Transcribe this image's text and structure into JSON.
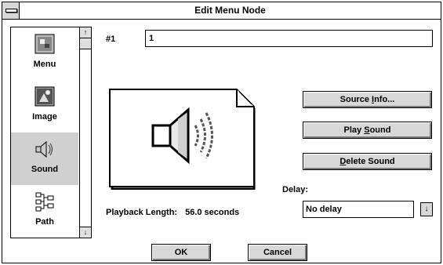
{
  "window": {
    "title": "Edit Menu Node"
  },
  "sidebar": {
    "items": [
      {
        "label": "Menu",
        "icon": "menu-icon",
        "selected": false
      },
      {
        "label": "Image",
        "icon": "image-icon",
        "selected": false
      },
      {
        "label": "Sound",
        "icon": "speaker-icon",
        "selected": true
      },
      {
        "label": "Path",
        "icon": "path-icon",
        "selected": false
      }
    ],
    "scroll_up_glyph": "↑",
    "scroll_down_glyph": "↓"
  },
  "node": {
    "number_label": "#1",
    "value": "1"
  },
  "buttons": {
    "source_info": {
      "pre": "Source ",
      "accel": "I",
      "post": "nfo..."
    },
    "play_sound": {
      "pre": "Play ",
      "accel": "S",
      "post": "ound"
    },
    "delete_sound": {
      "pre": "",
      "accel": "D",
      "post": "elete Sound"
    },
    "ok": "OK",
    "cancel": "Cancel"
  },
  "delay": {
    "label": "Delay:",
    "value": "No delay",
    "arrow_glyph": "↓"
  },
  "playback": {
    "label": "Playback Length:",
    "value": "56.0 seconds"
  }
}
